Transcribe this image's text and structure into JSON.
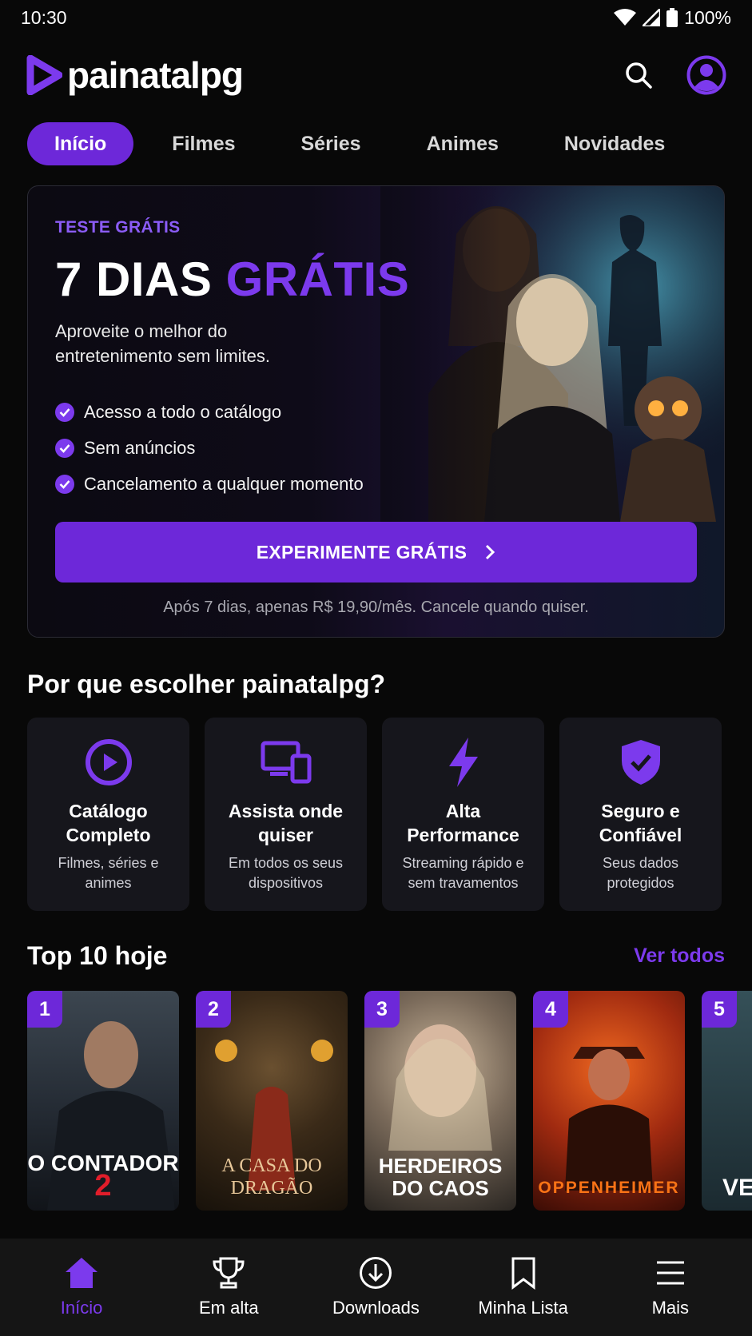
{
  "status": {
    "time": "10:30",
    "battery": "100%"
  },
  "header": {
    "logo_text": "painatalpg",
    "icons": [
      "search-icon",
      "profile-icon"
    ]
  },
  "tabs": [
    {
      "label": "Início",
      "active": true
    },
    {
      "label": "Filmes",
      "active": false
    },
    {
      "label": "Séries",
      "active": false
    },
    {
      "label": "Animes",
      "active": false
    },
    {
      "label": "Novidades",
      "active": false
    }
  ],
  "promo": {
    "kicker": "TESTE GRÁTIS",
    "title_main": "7 DIAS ",
    "title_accent": "GRÁTIS",
    "description": "Aproveite o melhor do entretenimento sem limites.",
    "features": [
      "Acesso a todo o catálogo",
      "Sem anúncios",
      "Cancelamento a qualquer momento"
    ],
    "cta_label": "EXPERIMENTE GRÁTIS",
    "note": "Após 7 dias, apenas R$ 19,90/mês. Cancele quando quiser."
  },
  "why": {
    "title": "Por que escolher painatalpg?",
    "cards": [
      {
        "icon": "play-circle-icon",
        "title": "Catálogo Completo",
        "subtitle": "Filmes, séries e animes"
      },
      {
        "icon": "devices-icon",
        "title": "Assista onde quiser",
        "subtitle": "Em todos os seus dispositivos"
      },
      {
        "icon": "lightning-icon",
        "title": "Alta Performance",
        "subtitle": "Streaming rápido e sem travamentos"
      },
      {
        "icon": "shield-check-icon",
        "title": "Seguro e Confiável",
        "subtitle": "Seus dados protegidos"
      }
    ]
  },
  "top10": {
    "title": "Top 10 hoje",
    "see_all": "Ver todos",
    "items": [
      {
        "rank": "1",
        "title_a": "O CONTADOR ",
        "title_b": "2"
      },
      {
        "rank": "2",
        "title_a": "A CASA DO",
        "title_b": "DRAGÃO"
      },
      {
        "rank": "3",
        "title_a": "HERDEIROS",
        "title_b": "DO CAOS"
      },
      {
        "rank": "4",
        "title_a": "OPPENHEIMER",
        "title_b": ""
      },
      {
        "rank": "5",
        "title_a": "VE",
        "title_b": ""
      }
    ]
  },
  "bottom_nav": [
    {
      "label": "Início",
      "icon": "home-icon",
      "active": true
    },
    {
      "label": "Em alta",
      "icon": "trophy-icon",
      "active": false
    },
    {
      "label": "Downloads",
      "icon": "download-icon",
      "active": false
    },
    {
      "label": "Minha Lista",
      "icon": "bookmark-icon",
      "active": false
    },
    {
      "label": "Mais",
      "icon": "menu-icon",
      "active": false
    }
  ]
}
